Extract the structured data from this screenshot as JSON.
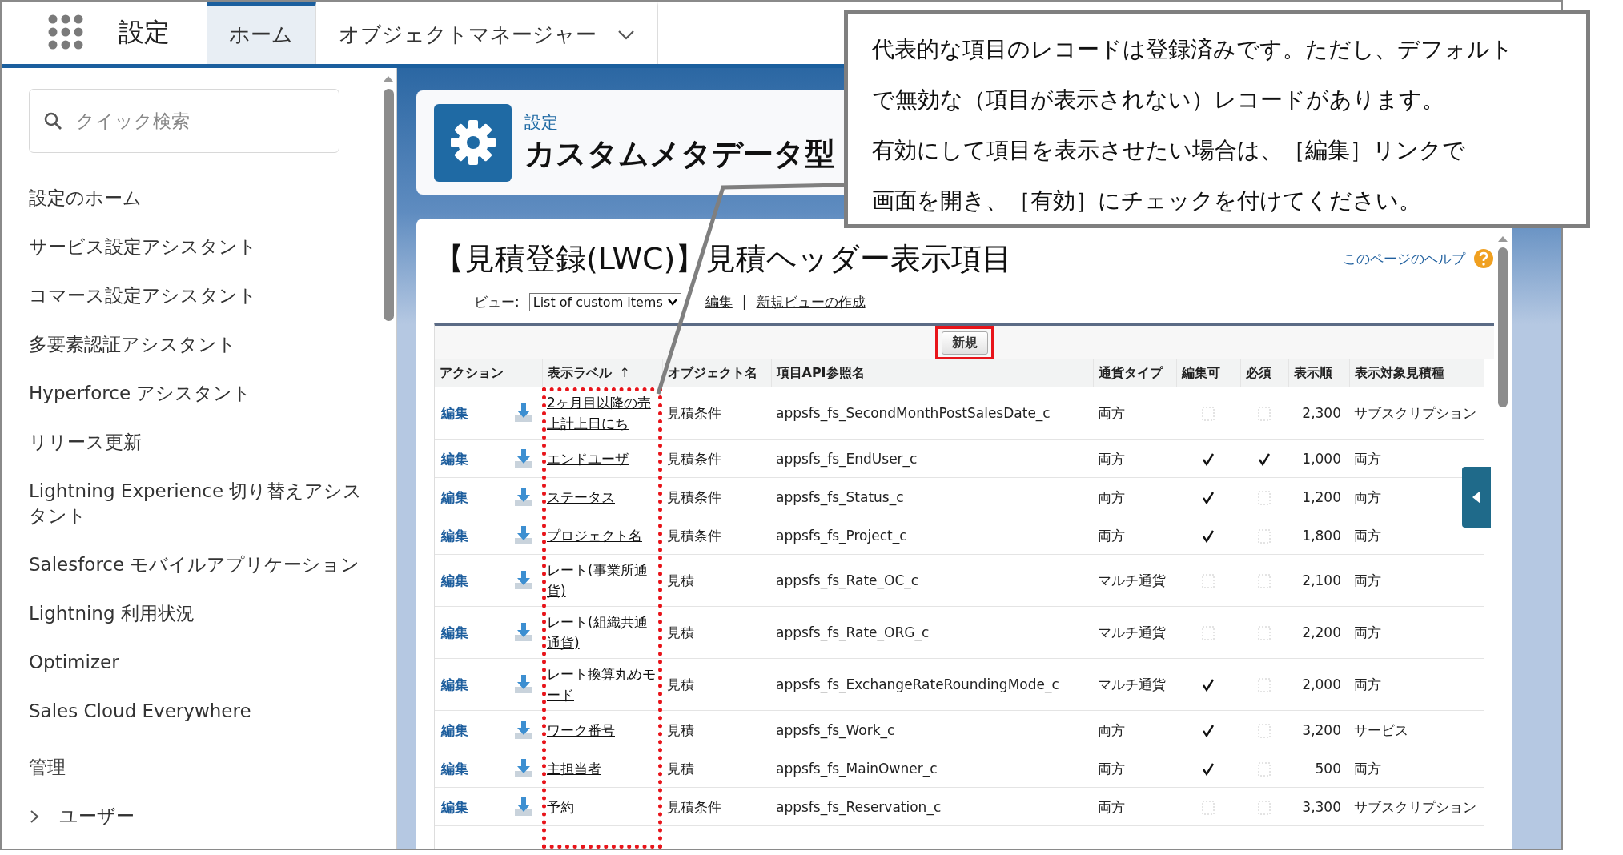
{
  "top_bar": {
    "app_title": "設定",
    "tabs": [
      {
        "label": "ホーム",
        "selected": true,
        "kind": "plain"
      },
      {
        "label": "オブジェクトマネージャー",
        "selected": false,
        "kind": "dropdown"
      }
    ]
  },
  "sidebar": {
    "search": {
      "placeholder": "クイック検索"
    },
    "items": [
      {
        "label": "設定のホーム",
        "kind": "link"
      },
      {
        "label": "サービス設定アシスタント",
        "kind": "link"
      },
      {
        "label": "コマース設定アシスタント",
        "kind": "link"
      },
      {
        "label": "多要素認証アシスタント",
        "kind": "link"
      },
      {
        "label": "Hyperforce アシスタント",
        "kind": "link"
      },
      {
        "label": "リリース更新",
        "kind": "link"
      },
      {
        "label": "Lightning Experience 切り替えアシスタント",
        "kind": "link"
      },
      {
        "label": "Salesforce モバイルアプリケーション",
        "kind": "link"
      },
      {
        "label": "Lightning 利用状況",
        "kind": "link"
      },
      {
        "label": "Optimizer",
        "kind": "link"
      },
      {
        "label": "Sales Cloud Everywhere",
        "kind": "link"
      },
      {
        "label": "管理",
        "kind": "section"
      },
      {
        "label": "ユーザー",
        "kind": "group",
        "expanded": false
      }
    ]
  },
  "page_header": {
    "breadcrumb": "設定",
    "title": "カスタムメタデータ型"
  },
  "content": {
    "title": "【見積登録(LWC)】見積ヘッダー表示項目",
    "help_link": "このページのヘルプ",
    "view": {
      "label": "ビュー:",
      "selected_option": "List of custom items",
      "links": [
        "編集",
        "新規ビューの作成"
      ],
      "separator": "|"
    },
    "new_button": "新規",
    "table": {
      "columns": [
        "アクション",
        "表示ラベル",
        "オブジェクト名",
        "項目API参照名",
        "通貨タイプ",
        "編集可",
        "必須",
        "表示順",
        "表示対象見積種"
      ],
      "sort_indicator": "↑",
      "rows": [
        {
          "action": "編集",
          "label": "2ヶ月目以降の売上計上日にち",
          "object": "見積条件",
          "api_name": "appsfs_fs_SecondMonthPostSalesDate_c",
          "currency_type": "両方",
          "editable": false,
          "required": false,
          "display_order": "2,300",
          "target": "サブスクリプション"
        },
        {
          "action": "編集",
          "label": "エンドユーザ",
          "object": "見積条件",
          "api_name": "appsfs_fs_EndUser_c",
          "currency_type": "両方",
          "editable": true,
          "required": true,
          "display_order": "1,000",
          "target": "両方"
        },
        {
          "action": "編集",
          "label": "ステータス",
          "object": "見積条件",
          "api_name": "appsfs_fs_Status_c",
          "currency_type": "両方",
          "editable": true,
          "required": false,
          "display_order": "1,200",
          "target": "両方"
        },
        {
          "action": "編集",
          "label": "プロジェクト名",
          "object": "見積条件",
          "api_name": "appsfs_fs_Project_c",
          "currency_type": "両方",
          "editable": true,
          "required": false,
          "display_order": "1,800",
          "target": "両方"
        },
        {
          "action": "編集",
          "label": "レート(事業所通貨)",
          "object": "見積",
          "api_name": "appsfs_fs_Rate_OC_c",
          "currency_type": "マルチ通貨",
          "editable": false,
          "required": false,
          "display_order": "2,100",
          "target": "両方"
        },
        {
          "action": "編集",
          "label": "レート(組織共通通貨)",
          "object": "見積",
          "api_name": "appsfs_fs_Rate_ORG_c",
          "currency_type": "マルチ通貨",
          "editable": false,
          "required": false,
          "display_order": "2,200",
          "target": "両方"
        },
        {
          "action": "編集",
          "label": "レート換算丸めモード",
          "object": "見積",
          "api_name": "appsfs_fs_ExchangeRateRoundingMode_c",
          "currency_type": "マルチ通貨",
          "editable": true,
          "required": false,
          "display_order": "2,000",
          "target": "両方"
        },
        {
          "action": "編集",
          "label": "ワーク番号",
          "object": "見積",
          "api_name": "appsfs_fs_Work_c",
          "currency_type": "両方",
          "editable": true,
          "required": false,
          "display_order": "3,200",
          "target": "サービス"
        },
        {
          "action": "編集",
          "label": "主担当者",
          "object": "見積",
          "api_name": "appsfs_fs_MainOwner_c",
          "currency_type": "両方",
          "editable": true,
          "required": false,
          "display_order": "500",
          "target": "両方"
        },
        {
          "action": "編集",
          "label": "予約",
          "object": "見積条件",
          "api_name": "appsfs_fs_Reservation_c",
          "currency_type": "両方",
          "editable": false,
          "required": false,
          "display_order": "3,300",
          "target": "サブスクリプション"
        }
      ]
    }
  },
  "callout": {
    "lines": [
      "代表的な項目のレコードは登録済みです。ただし、デフォルト",
      "で無効な（項目が表示されない）レコードがあります。",
      "有効にして項目を表示させたい場合は、［編集］リンクで",
      "画面を開き、［有効］にチェックを付けてください。"
    ]
  }
}
